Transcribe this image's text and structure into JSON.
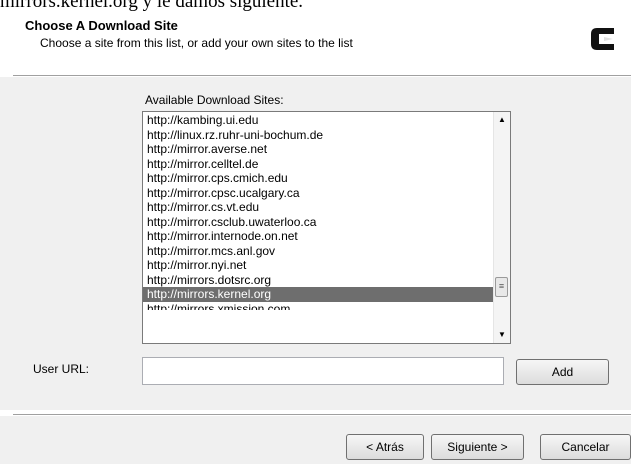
{
  "background_caption": "mirrors.kernel.org y le damos siguiente.",
  "header": {
    "title": "Choose A Download Site",
    "subtitle": "Choose a site from this list, or add your own sites to the list"
  },
  "sites_list": {
    "label": "Available Download Sites:",
    "items": [
      "http://kambing.ui.edu",
      "http://linux.rz.ruhr-uni-bochum.de",
      "http://mirror.averse.net",
      "http://mirror.celltel.de",
      "http://mirror.cps.cmich.edu",
      "http://mirror.cpsc.ucalgary.ca",
      "http://mirror.cs.vt.edu",
      "http://mirror.csclub.uwaterloo.ca",
      "http://mirror.internode.on.net",
      "http://mirror.mcs.anl.gov",
      "http://mirror.nyi.net",
      "http://mirrors.dotsrc.org",
      "http://mirrors.kernel.org",
      "http://mirrors.xmission.com"
    ],
    "selected": "http://mirrors.kernel.org"
  },
  "user_url": {
    "label": "User URL:",
    "value": ""
  },
  "buttons": {
    "add": "Add",
    "back": "< Atrás",
    "next": "Siguiente >",
    "cancel": "Cancelar"
  }
}
